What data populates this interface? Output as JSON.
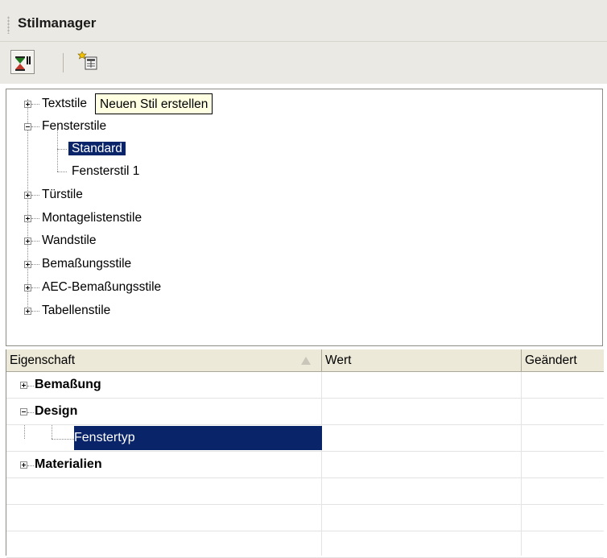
{
  "window": {
    "title": "Stilmanager"
  },
  "toolbar": {
    "buttons": [
      {
        "icon": "filter-style-icon",
        "pressed": true
      },
      {
        "icon": "new-style-icon",
        "pressed": false
      }
    ]
  },
  "tooltip": {
    "text": "Neuen Stil erstellen"
  },
  "tree": {
    "items": [
      {
        "label": "Textstile",
        "expanded": false
      },
      {
        "label": "Fensterstile",
        "expanded": true,
        "children": [
          {
            "label": "Standard",
            "selected": true
          },
          {
            "label": "Fensterstil 1"
          }
        ]
      },
      {
        "label": "Türstile",
        "expanded": false
      },
      {
        "label": "Montagelistenstile",
        "expanded": false
      },
      {
        "label": "Wandstile",
        "expanded": false
      },
      {
        "label": "Bemaßungsstile",
        "expanded": false
      },
      {
        "label": "AEC-Bemaßungsstile",
        "expanded": false
      },
      {
        "label": "Tabellenstile",
        "expanded": false
      }
    ]
  },
  "grid": {
    "columns": [
      "Eigenschaft",
      "Wert",
      "Geändert"
    ],
    "rows": [
      {
        "label": "Bemaßung",
        "expanded": false
      },
      {
        "label": "Design",
        "expanded": true,
        "children": [
          {
            "label": "Fenstertyp",
            "selected": true
          }
        ]
      },
      {
        "label": "Materialien",
        "expanded": false
      }
    ]
  },
  "colors": {
    "selection": "#0a246a",
    "chrome": "#ebe9e3",
    "tooltip_bg": "#ffffe1"
  }
}
